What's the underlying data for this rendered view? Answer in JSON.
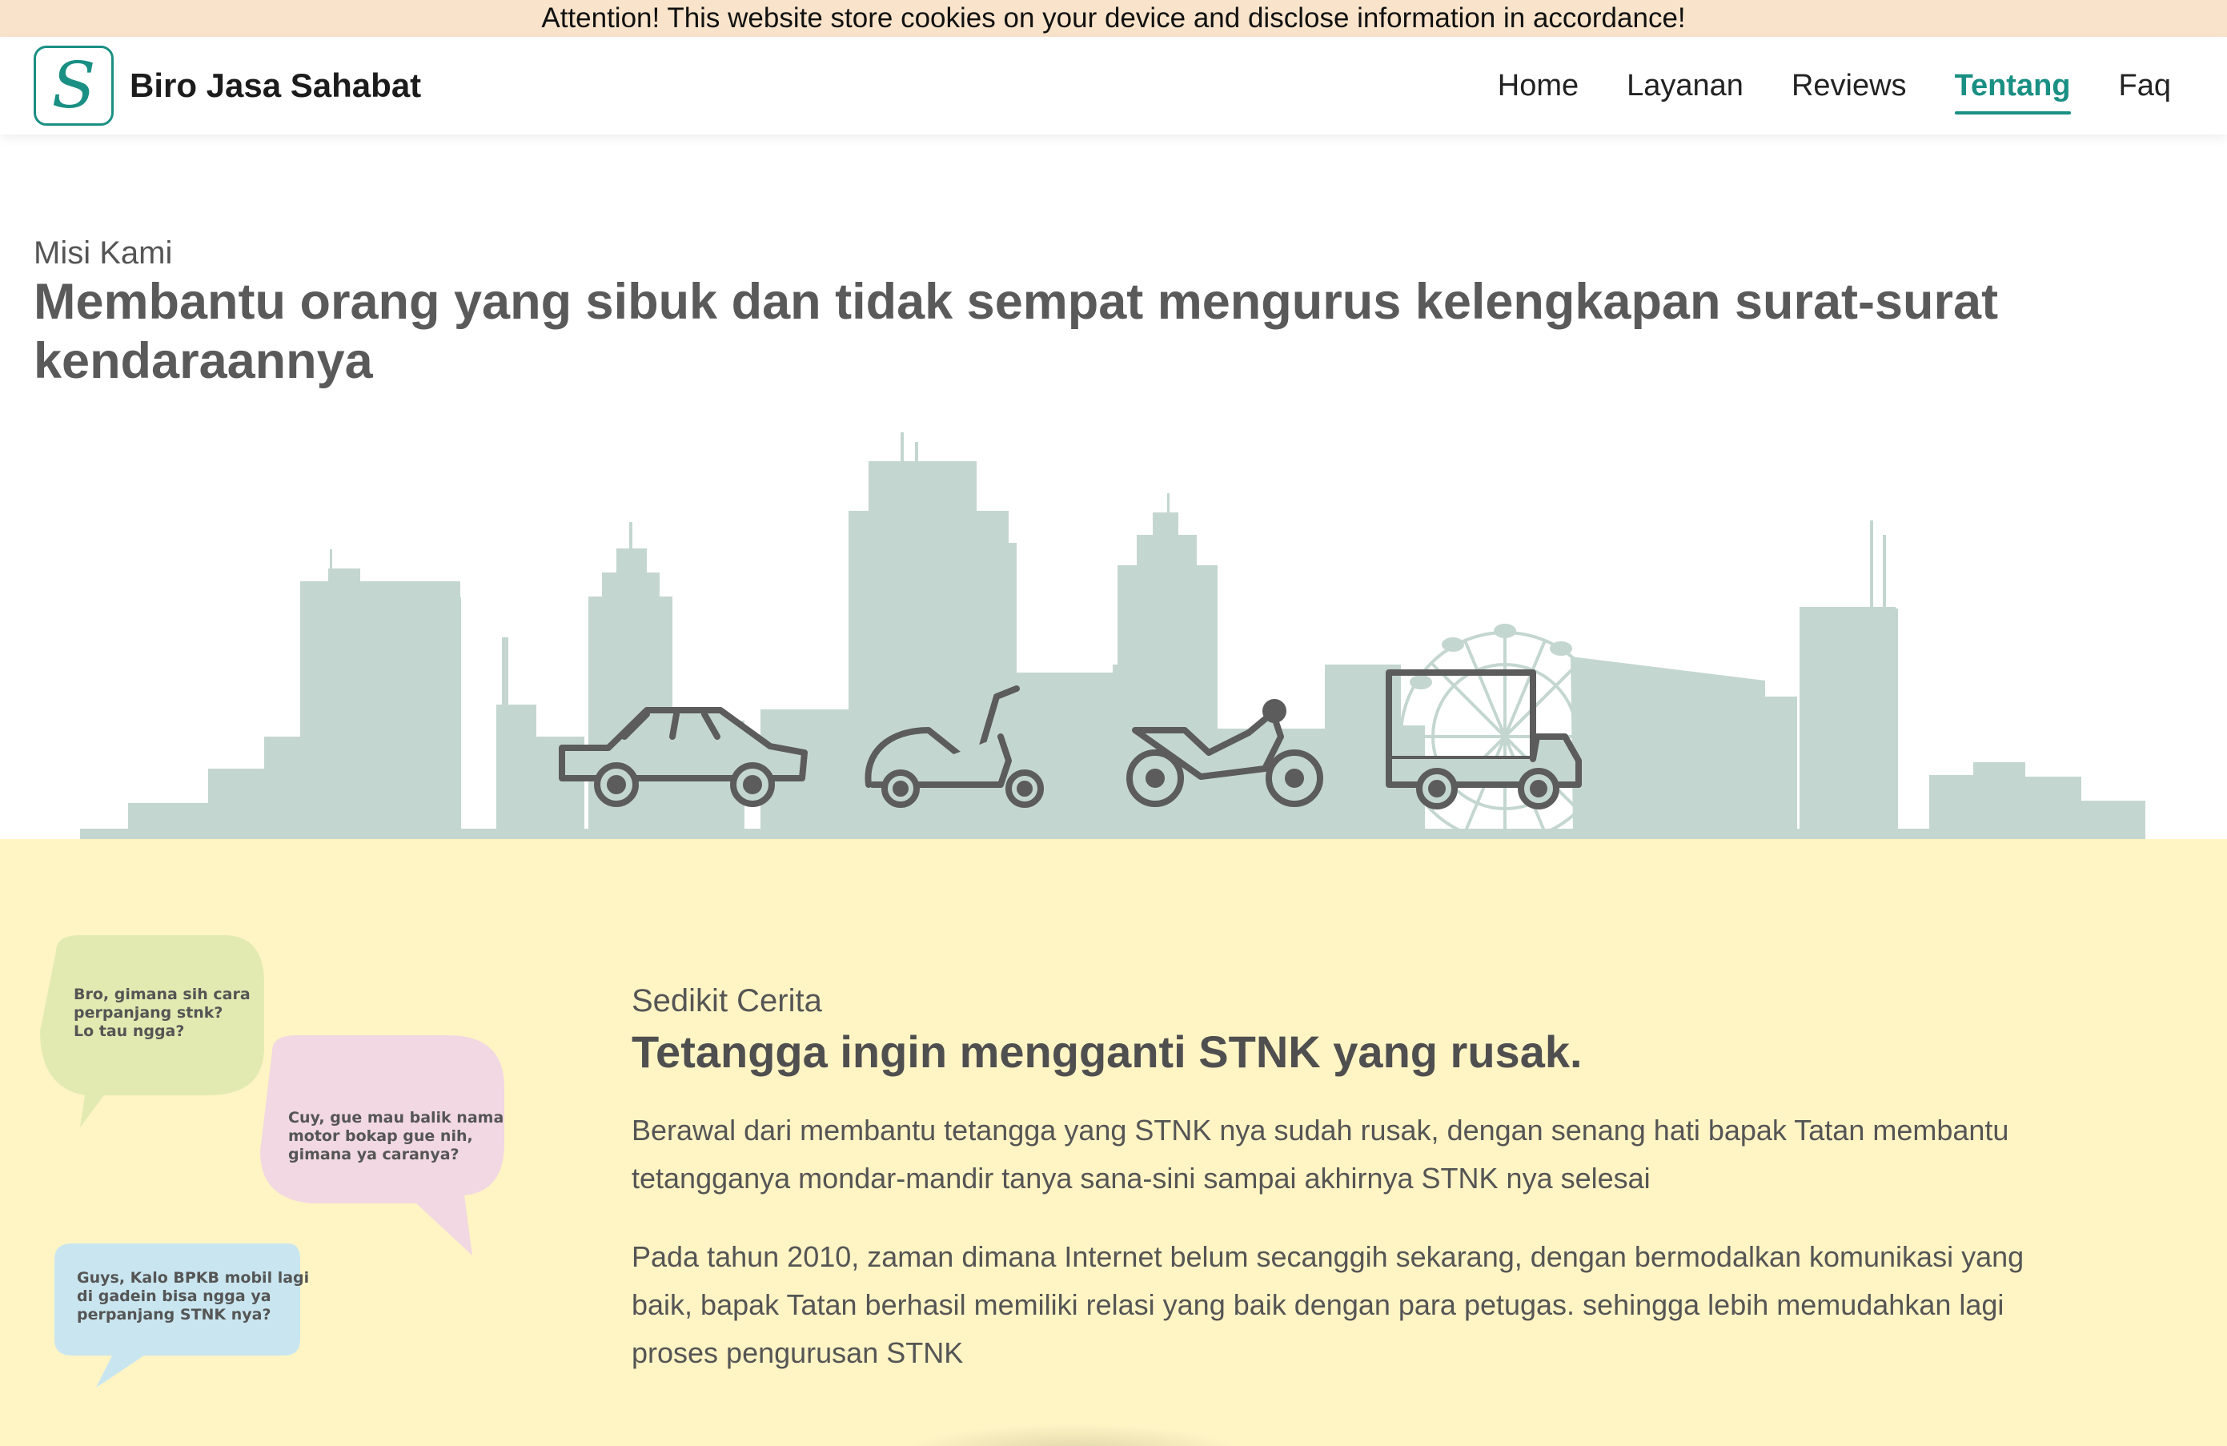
{
  "cookie_banner": {
    "text": "Attention! This website store cookies on your device and disclose information in accordance!"
  },
  "header": {
    "brand_letter": "S",
    "brand_name": "Biro Jasa Sahabat",
    "nav": [
      {
        "label": "Home",
        "active": false
      },
      {
        "label": "Layanan",
        "active": false
      },
      {
        "label": "Reviews",
        "active": false
      },
      {
        "label": "Tentang",
        "active": true
      },
      {
        "label": "Faq",
        "active": false
      }
    ]
  },
  "mission": {
    "kicker": "Misi Kami",
    "title": "Membantu orang yang sibuk dan tidak sempat mengurus kelengkapan surat-surat kendaraannya"
  },
  "story": {
    "kicker": "Sedikit Cerita",
    "title": "Tetangga ingin mengganti STNK yang rusak.",
    "paragraphs": [
      "Berawal dari membantu tetangga yang STNK nya sudah rusak, dengan senang hati bapak Tatan membantu tetangganya mondar-mandir tanya sana-sini sampai akhirnya STNK nya selesai",
      "Pada tahun 2010, zaman dimana Internet belum secanggih sekarang, dengan bermodalkan komunikasi yang baik, bapak Tatan berhasil memiliki relasi yang baik dengan para petugas. sehingga lebih memudahkan lagi proses pengurusan STNK"
    ],
    "bubbles": [
      {
        "lines": [
          "Bro, gimana sih cara",
          "perpanjang stnk?",
          "Lo tau ngga?"
        ],
        "color": "#e2eab2"
      },
      {
        "lines": [
          "Cuy, gue mau balik nama",
          "motor bokap gue nih,",
          "gimana ya caranya?"
        ],
        "color": "#f1d8e2"
      },
      {
        "lines": [
          "Guys, Kalo BPKB mobil lagi",
          "di gadein bisa ngga ya",
          "perpanjang STNK nya?"
        ],
        "color": "#c9e6f0"
      }
    ]
  },
  "colors": {
    "accent": "#1a8f83",
    "skyline": "#c4d6d0",
    "vehicle_stroke": "#5c5c5c",
    "story_bg": "#fff4c4",
    "cookie_bg": "#f9e4cb"
  },
  "icons": {
    "brand": "script-s-logo-icon",
    "vehicles": [
      "car-icon",
      "scooter-icon",
      "motorcycle-icon",
      "pickup-truck-icon"
    ]
  }
}
